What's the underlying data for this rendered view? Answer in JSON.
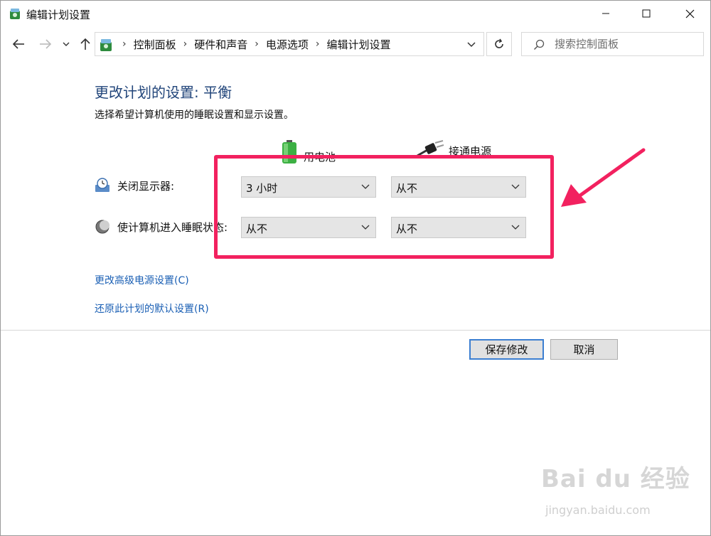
{
  "window": {
    "title": "编辑计划设置",
    "title_icon": "power-options-icon",
    "controls": {
      "minimize": "minimize-icon",
      "maximize": "maximize-icon",
      "close": "close-icon"
    }
  },
  "nav": {
    "back_icon": "arrow-left-icon",
    "forward_icon": "arrow-right-icon",
    "recent_icon": "chevron-down-icon",
    "up_icon": "arrow-up-icon"
  },
  "address_bar": {
    "breadcrumbs": [
      "控制面板",
      "硬件和声音",
      "电源选项",
      "编辑计划设置"
    ],
    "separator": "›",
    "refresh_icon": "refresh-icon"
  },
  "search": {
    "placeholder": "搜索控制面板"
  },
  "content": {
    "heading": "更改计划的设置: 平衡",
    "subtitle": "选择希望计算机使用的睡眠设置和显示设置。",
    "columns": [
      {
        "label": "用电池",
        "icon": "battery-icon"
      },
      {
        "label": "接通电源",
        "icon": "power-plug-icon"
      }
    ],
    "settings": [
      {
        "label": "关闭显示器:",
        "icon": "display-clock-icon",
        "battery_value": "3 小时",
        "plugged_value": "从不"
      },
      {
        "label": "使计算机进入睡眠状态:",
        "icon": "sleep-moon-icon",
        "battery_value": "从不",
        "plugged_value": "从不"
      }
    ],
    "links": [
      "更改高级电源设置(C)",
      "还原此计划的默认设置(R)"
    ]
  },
  "buttons": {
    "save": "保存修改",
    "cancel": "取消"
  },
  "annotation": {
    "highlight_color": "#f2215f"
  },
  "watermark": {
    "main": "Bai du 经验",
    "sub": "jingyan.baidu.com"
  }
}
